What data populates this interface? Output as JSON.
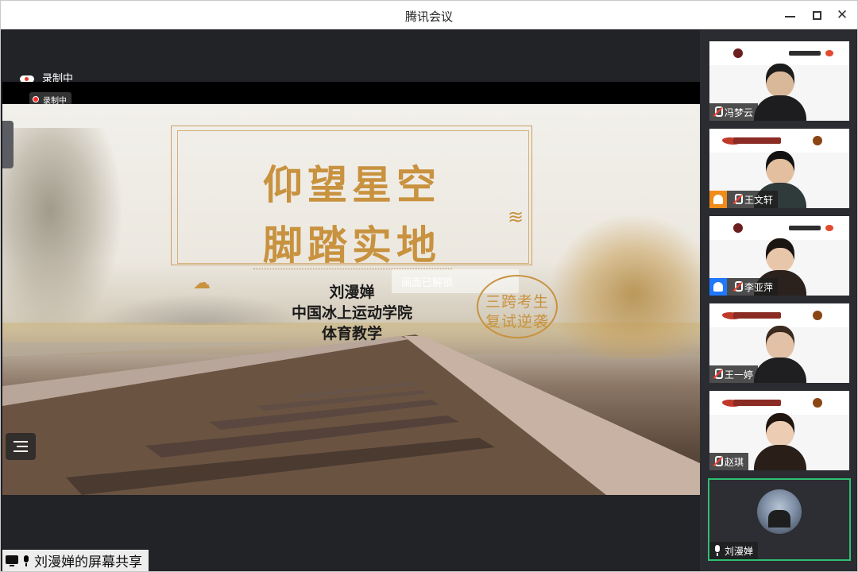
{
  "window": {
    "title": "腾讯会议"
  },
  "recording": {
    "top_label": "录制中",
    "badge_label": "录制中"
  },
  "slide": {
    "title_line1": "仰望星空",
    "title_line2": "脚踏实地",
    "presenter_name": "刘漫婵",
    "presenter_school": "中国冰上运动学院",
    "presenter_major": "体育教学",
    "stamp_line1": "三跨考生",
    "stamp_line2": "复试逆袭",
    "unlock_tip": "画面已解锁"
  },
  "share": {
    "label": "刘漫婵的屏幕共享"
  },
  "participants": [
    {
      "name": "冯梦云",
      "mic": "muted",
      "host": false
    },
    {
      "name": "王文轩",
      "mic": "muted",
      "host": true,
      "host_color": "#f08c1a"
    },
    {
      "name": "李亚萍",
      "mic": "muted",
      "host": true,
      "host_color": "#1f78ff"
    },
    {
      "name": "王一婷",
      "mic": "muted",
      "host": false
    },
    {
      "name": "赵琪",
      "mic": "muted",
      "host": false
    },
    {
      "name": "刘漫婵",
      "mic": "on",
      "host": false,
      "active_speaker": true
    }
  ],
  "colors": {
    "accent_gold": "#c8923f",
    "active_border": "#2fbf71",
    "muted_red": "#ff3b30"
  }
}
